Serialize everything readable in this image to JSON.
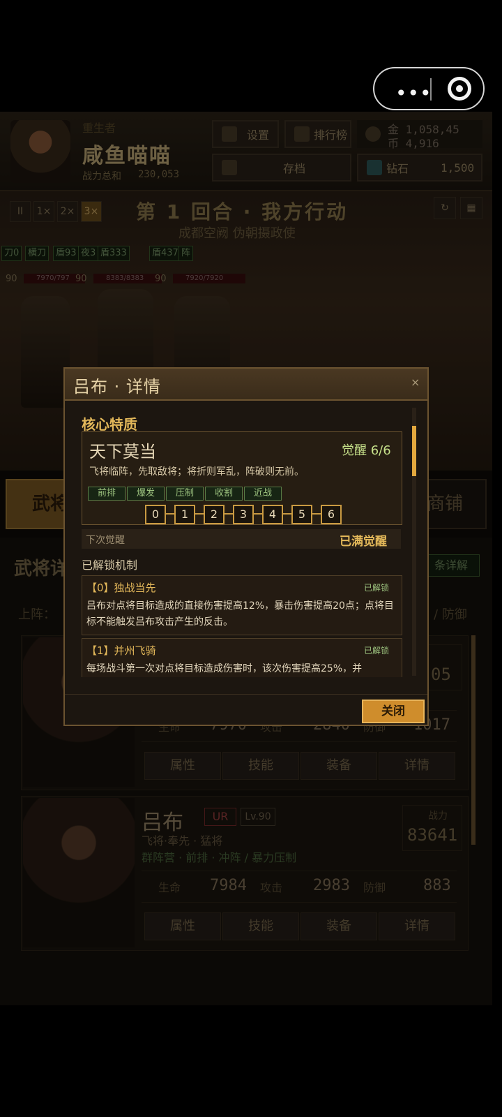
{
  "capsule": {
    "menu_icon": "more-dots-icon",
    "close_icon": "target-icon"
  },
  "player": {
    "rebirth_label": "重生者",
    "name": "咸鱼喵喵",
    "power_label": "战力总和",
    "power_value": "230,053"
  },
  "header": {
    "settings_label": "设置",
    "ranking_label": "排行榜",
    "save_label": "存档",
    "gold_label": "金 1,058,45",
    "coin_label": "币 4,916",
    "diamond_label": "钻石",
    "diamond_value": "1,500"
  },
  "battle": {
    "speeds": [
      "II",
      "1×",
      "2×",
      "3×"
    ],
    "round_title": "第 1 回合 · 我方行动",
    "stage": "成都空阙 伪朝摄政使",
    "tags": [
      "刀0",
      "横刀",
      "盾93",
      "夜3",
      "盾333",
      "盾437",
      "阵"
    ],
    "levels": [
      "90",
      "90",
      "90"
    ],
    "hp": [
      "7970/797",
      "8383/8383",
      "7920/7920"
    ]
  },
  "tabs": {
    "left": "武将",
    "right": "商铺"
  },
  "list": {
    "title": "武将详",
    "detail_btn": "条详解",
    "filter": "上阵：",
    "filter_right": "/ 防御"
  },
  "card1": {
    "power_partial": "05",
    "hp_label": "生命",
    "hp": "7970",
    "atk_label": "攻击",
    "atk": "2840",
    "def_label": "防御",
    "def": "1017",
    "btns": [
      "属性",
      "技能",
      "装备",
      "详情"
    ]
  },
  "card2": {
    "name": "吕布",
    "rarity": "UR",
    "level": "Lv.90",
    "line1": "飞将·奉先 · 猛将",
    "line2": "群阵营 · 前排 · 冲阵 / 暴力压制",
    "power_label": "战力",
    "power": "83641",
    "hp_label": "生命",
    "hp": "7984",
    "atk_label": "攻击",
    "atk": "2983",
    "def_label": "防御",
    "def": "883",
    "btns": [
      "属性",
      "技能",
      "装备",
      "详情"
    ]
  },
  "modal": {
    "title": "吕布 · 详情",
    "close_x": "×",
    "section_title": "核心特质",
    "trait_name": "天下莫当",
    "awaken": "觉醒 6/6",
    "trait_desc": "飞将临阵，先取敌将；将折则军乱，阵破则无前。",
    "tags": [
      "前排",
      "爆发",
      "压制",
      "收割",
      "近战"
    ],
    "levels": [
      "0",
      "1",
      "2",
      "3",
      "4",
      "5",
      "6"
    ],
    "next_label": "下次觉醒",
    "next_value": "已满觉醒",
    "unlocked_title": "已解锁机制",
    "mechanisms": [
      {
        "name": "【0】独战当先",
        "status": "已解锁",
        "text": "吕布对点将目标造成的直接伤害提高12%，暴击伤害提高20点；点将目标不能触发吕布攻击产生的反击。"
      },
      {
        "name": "【1】并州飞骑",
        "status": "已解锁",
        "text": "每场战斗第一次对点将目标造成伤害时，该次伤害提高25%，并"
      }
    ],
    "close_button": "关闭"
  },
  "colors": {
    "accent": "#e3b85a",
    "button": "#cf8d2c",
    "tag_green": "#9cc27e"
  }
}
